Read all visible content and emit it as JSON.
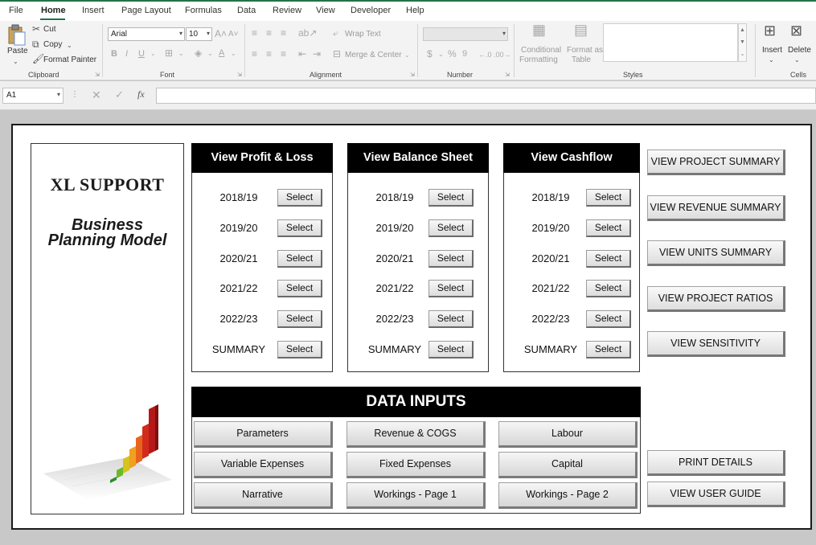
{
  "menu": {
    "tabs": [
      "File",
      "Home",
      "Insert",
      "Page Layout",
      "Formulas",
      "Data",
      "Review",
      "View",
      "Developer",
      "Help"
    ]
  },
  "ribbon": {
    "clipboard": {
      "paste": "Paste",
      "cut": "Cut",
      "copy": "Copy",
      "format_painter": "Format Painter",
      "label": "Clipboard"
    },
    "font": {
      "name": "Arial",
      "size": "10",
      "label": "Font"
    },
    "alignment": {
      "wrap_text": "Wrap Text",
      "merge_center": "Merge & Center",
      "label": "Alignment"
    },
    "number": {
      "label": "Number"
    },
    "styles": {
      "conditional_1": "Conditional",
      "conditional_2": "Formatting",
      "format_as_1": "Format as",
      "format_as_2": "Table",
      "label": "Styles"
    },
    "cells": {
      "insert": "Insert",
      "delete": "Delete",
      "label": "Cells"
    }
  },
  "formula_bar": {
    "name_box": "A1",
    "fx": "fx",
    "value": ""
  },
  "brand": {
    "title": "XL SUPPORT",
    "subtitle_line1": "Business",
    "subtitle_line2": "Planning Model"
  },
  "sections": [
    {
      "title": "View Profit & Loss",
      "rows": [
        {
          "label": "2018/19",
          "button": "Select"
        },
        {
          "label": "2019/20",
          "button": "Select"
        },
        {
          "label": "2020/21",
          "button": "Select"
        },
        {
          "label": "2021/22",
          "button": "Select"
        },
        {
          "label": "2022/23",
          "button": "Select"
        },
        {
          "label": "SUMMARY",
          "button": "Select"
        }
      ]
    },
    {
      "title": "View Balance Sheet",
      "rows": [
        {
          "label": "2018/19",
          "button": "Select"
        },
        {
          "label": "2019/20",
          "button": "Select"
        },
        {
          "label": "2020/21",
          "button": "Select"
        },
        {
          "label": "2021/22",
          "button": "Select"
        },
        {
          "label": "2022/23",
          "button": "Select"
        },
        {
          "label": "SUMMARY",
          "button": "Select"
        }
      ]
    },
    {
      "title": "View Cashflow",
      "rows": [
        {
          "label": "2018/19",
          "button": "Select"
        },
        {
          "label": "2019/20",
          "button": "Select"
        },
        {
          "label": "2020/21",
          "button": "Select"
        },
        {
          "label": "2021/22",
          "button": "Select"
        },
        {
          "label": "2022/23",
          "button": "Select"
        },
        {
          "label": "SUMMARY",
          "button": "Select"
        }
      ]
    }
  ],
  "view_buttons": [
    "VIEW PROJECT SUMMARY",
    "VIEW REVENUE SUMMARY",
    "VIEW UNITS SUMMARY",
    "VIEW PROJECT RATIOS",
    "VIEW SENSITIVITY"
  ],
  "data_inputs": {
    "title": "DATA INPUTS",
    "buttons": [
      "Parameters",
      "Revenue & COGS",
      "Labour",
      "Variable Expenses",
      "Fixed Expenses",
      "Capital",
      "Narrative",
      "Workings - Page 1",
      "Workings - Page 2"
    ]
  },
  "bottom_buttons": [
    "PRINT DETAILS",
    "VIEW USER GUIDE"
  ],
  "colors": {
    "excel_green": "#217346",
    "header_black": "#000000",
    "sheet_gray": "#c8c8c8"
  }
}
